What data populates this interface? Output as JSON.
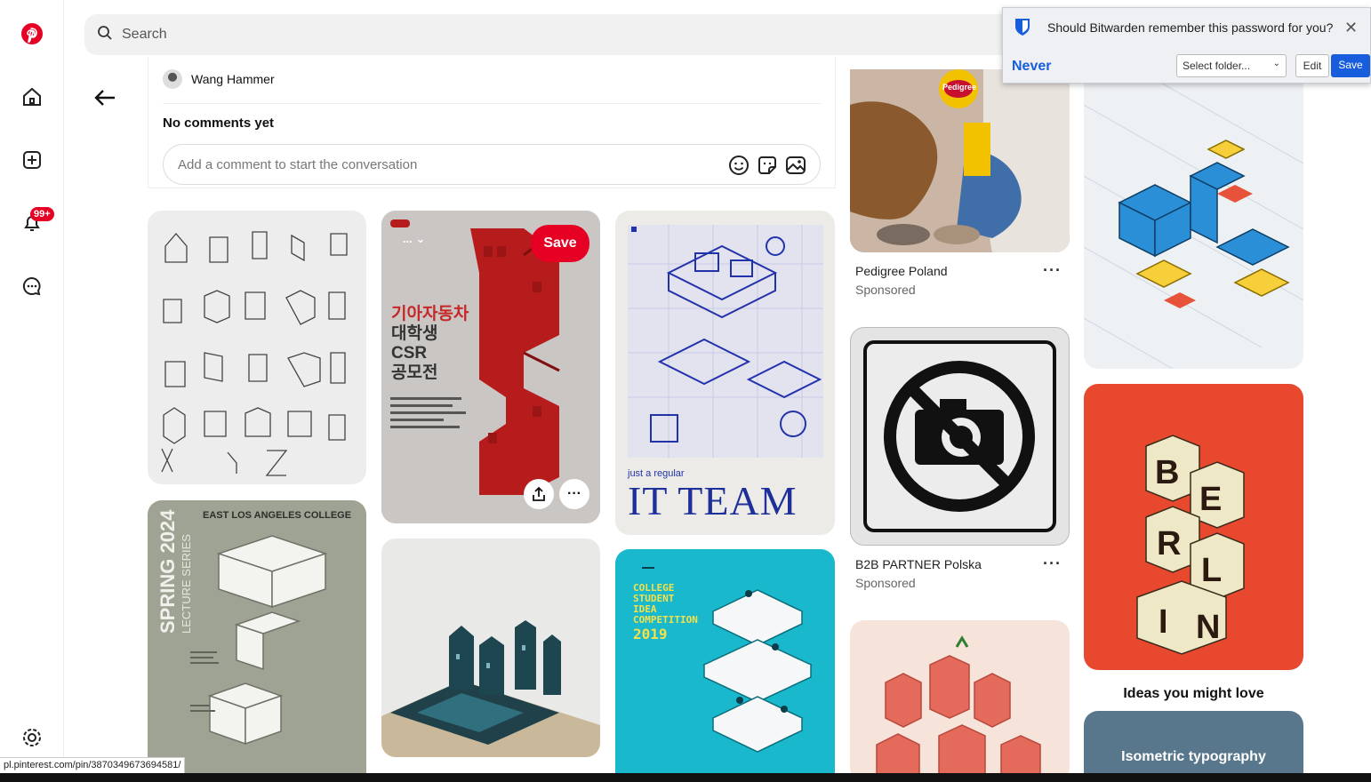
{
  "nav": {
    "items": [
      "pinterest-logo",
      "home",
      "create",
      "notifications",
      "messages",
      "settings"
    ],
    "notification_badge": "99+"
  },
  "search": {
    "label": "Search"
  },
  "comments": {
    "author": "Wang Hammer",
    "heading": "No comments yet",
    "placeholder": "Add a comment to start the conversation"
  },
  "pins": {
    "col2_top": {
      "save_label": "Save",
      "board_dropdown": "...",
      "korean_title": [
        "기아자동차",
        "대학생",
        "CSR",
        "공모전"
      ]
    },
    "it_team": {
      "small": "just a regular",
      "big": "IT TEAM"
    },
    "spring": {
      "title": "SPRING 2024",
      "series": "LECTURE SERIES",
      "college": "EAST LOS ANGELES COLLEGE"
    },
    "college": {
      "lines": [
        "COLLEGE",
        "STUDENT",
        "IDEA",
        "COMPETITION",
        "2019"
      ]
    },
    "pedigree": {
      "brand": "Pedigree",
      "name": "Pedigree Poland",
      "sponsored": "Sponsored"
    },
    "b2b": {
      "name": "B2B PARTNER Polska",
      "sponsored": "Sponsored"
    },
    "berlin": {
      "letters": [
        "B",
        "E",
        "R",
        "L",
        "I",
        "N"
      ]
    },
    "ideas": {
      "heading": "Ideas you might love",
      "card": "Isometric typography"
    }
  },
  "bitwarden": {
    "question": "Should Bitwarden remember this password for you?",
    "never": "Never",
    "folder": "Select folder...",
    "edit": "Edit",
    "save": "Save"
  },
  "statusbar": {
    "url": "pl.pinterest.com/pin/3870349673694581/"
  },
  "colors": {
    "brand": "#e60023",
    "bitwarden": "#175ddc"
  }
}
